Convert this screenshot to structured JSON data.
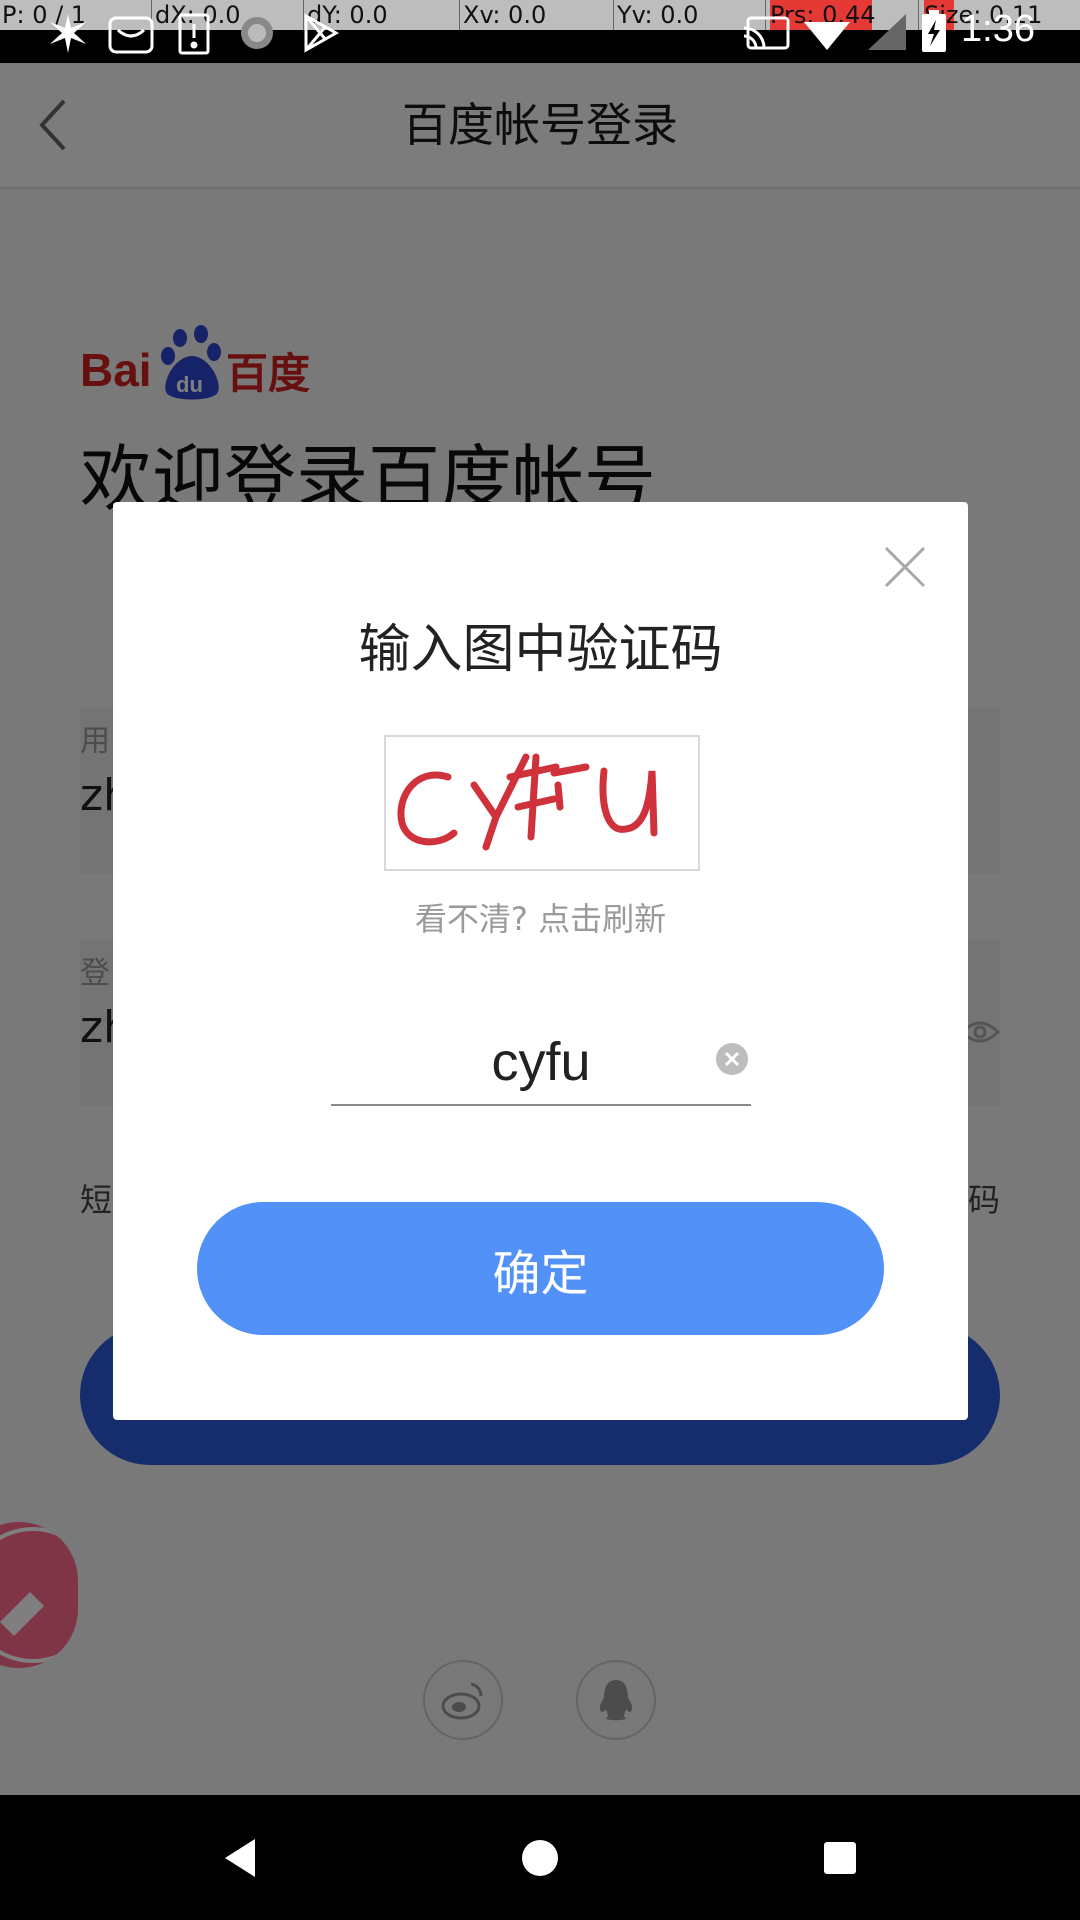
{
  "debug": {
    "pointer": "P: 0 / 1",
    "dx": "dX: 0.0",
    "dy": "dY: 0.0",
    "xv": "Xv: 0.0",
    "yv": "Yv: 0.0",
    "prs": "Prs: 0.44",
    "size": "Size: 0.11"
  },
  "status": {
    "time": "1:36"
  },
  "header": {
    "title": "百度帐号登录",
    "back_icon": "chevron-left-icon"
  },
  "login": {
    "logo_text": "Bai du 百度",
    "welcome": "欢迎登录百度帐号",
    "username": {
      "label": "用",
      "value": "zh"
    },
    "password": {
      "label": "登",
      "value": "zh"
    },
    "sms_link": "短",
    "forgot_link": "码"
  },
  "modal": {
    "title": "输入图中验证码",
    "captcha_text": "CYFU",
    "refresh_hint": "看不清? 点击刷新",
    "code_value": "cyfu",
    "confirm_label": "确定"
  },
  "social": {
    "items": [
      "weibo-icon",
      "qq-icon"
    ]
  },
  "colors": {
    "confirm": "#5291f7",
    "login_button": "#2a5bd8",
    "captcha_red": "#d0323c",
    "baidu_red": "#d0201e",
    "baidu_blue": "#2f46d1"
  }
}
